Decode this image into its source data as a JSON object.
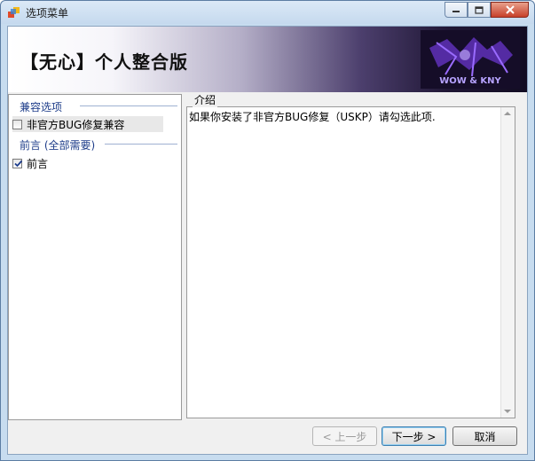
{
  "window": {
    "title": "选项菜单"
  },
  "banner": {
    "title": "【无心】个人整合版",
    "logo_text": "WOW & KNY"
  },
  "left_panel": {
    "groups": [
      {
        "header": "兼容选项",
        "items": [
          {
            "label": "非官方BUG修复兼容",
            "checked": false
          }
        ]
      },
      {
        "header": "前言 (全部需要)",
        "items": [
          {
            "label": "前言",
            "checked": true
          }
        ]
      }
    ]
  },
  "description": {
    "label": "介绍",
    "text": "如果你安装了非官方BUG修复（USKP）请勾选此项."
  },
  "buttons": {
    "back": "< 上一步",
    "next": "下一步 >",
    "cancel": "取消"
  },
  "colors": {
    "group_header": "#1e3d8a",
    "title_bar": "#c7dcef"
  }
}
